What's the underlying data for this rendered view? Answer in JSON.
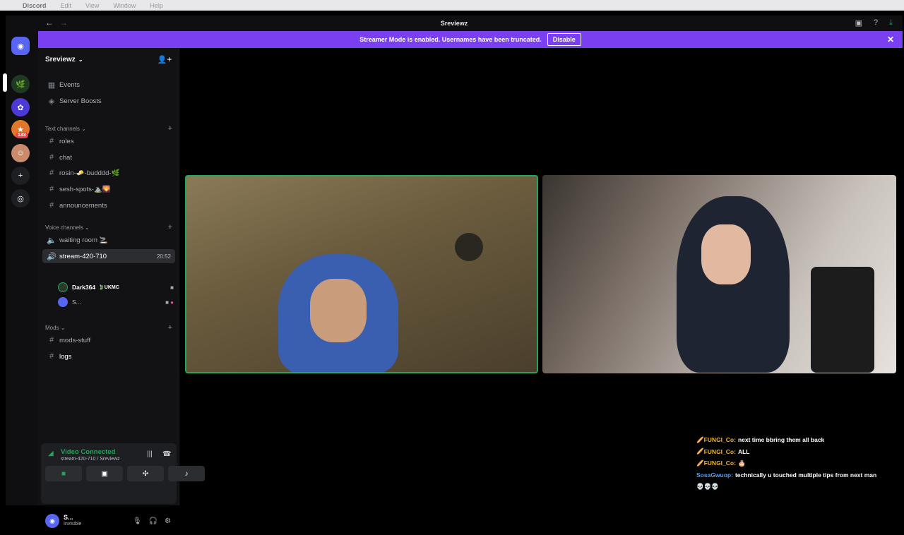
{
  "menubar": {
    "app": "Discord",
    "items": [
      "Edit",
      "View",
      "Window",
      "Help"
    ]
  },
  "window": {
    "title": "Sreviewz"
  },
  "banner": {
    "text": "Streamer Mode is enabled. Usernames have been truncated.",
    "button": "Disable"
  },
  "rail": {
    "badge": "133"
  },
  "server": {
    "name": "Sreviewz"
  },
  "nav": {
    "events": "Events",
    "boosts": "Server Boosts"
  },
  "categories": {
    "text": "Text channels",
    "voice": "Voice channels",
    "mods": "Mods"
  },
  "text_channels": [
    "roles",
    "chat",
    "rosin-🧈-budddd-🌿",
    "sesh-spots-⛰️🌄",
    "announcements"
  ],
  "voice_channels": {
    "waiting": "waiting room 🚬",
    "stream": "stream-420-710",
    "timer": "20:52"
  },
  "voice_users": [
    {
      "name": "Dark364",
      "tag": "🍃UKMC"
    },
    {
      "name": "S..."
    }
  ],
  "mod_channels": [
    "mods-stuff",
    "logs"
  ],
  "voice_connection": {
    "status": "Video Connected",
    "location": "stream-420-710 / Sreviewz"
  },
  "user_panel": {
    "name": "S...",
    "status": "Invisible"
  },
  "chat_overlay": [
    {
      "prefix": "🥖",
      "name": "FUNGI_Co:",
      "msg": "next time bbring them all back"
    },
    {
      "prefix": "🥖",
      "name": "FUNGI_Co:",
      "msg": "ALL"
    },
    {
      "prefix": "🥖",
      "name": "FUNGI_Co:",
      "msg": "🎂"
    },
    {
      "prefix": "",
      "name": "SosaGwuop:",
      "msg": "technically u touched multiple tips from next man"
    },
    {
      "prefix": "",
      "name": "",
      "msg": "💀💀💀"
    }
  ],
  "colors": {
    "accent": "#7b3ff2",
    "connected": "#23a55a",
    "speaking_border": "#23a55a"
  }
}
